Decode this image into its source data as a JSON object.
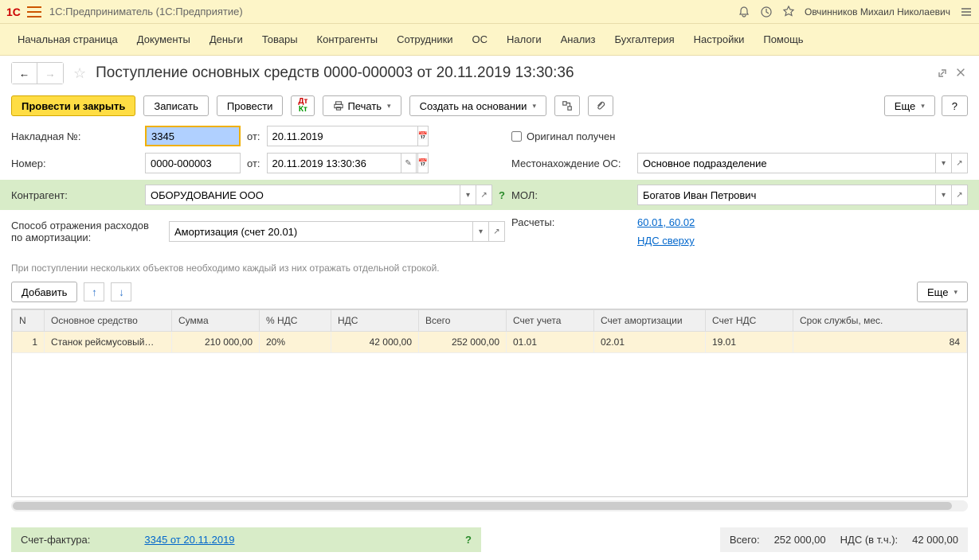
{
  "app": {
    "logo": "1C",
    "title": "1С:Предприниматель  (1С:Предприятие)",
    "user": "Овчинников Михаил Николаевич"
  },
  "menu": [
    "Начальная страница",
    "Документы",
    "Деньги",
    "Товары",
    "Контрагенты",
    "Сотрудники",
    "ОС",
    "Налоги",
    "Анализ",
    "Бухгалтерия",
    "Настройки",
    "Помощь"
  ],
  "page": {
    "title": "Поступление основных средств 0000-000003 от 20.11.2019 13:30:36"
  },
  "actions": {
    "post_close": "Провести и закрыть",
    "save": "Записать",
    "post": "Провести",
    "print": "Печать",
    "create_based": "Создать на основании",
    "more": "Еще",
    "help": "?"
  },
  "form": {
    "invoice_label": "Накладная №:",
    "invoice_no": "3345",
    "from_label": "от:",
    "invoice_date": "20.11.2019",
    "number_label": "Номер:",
    "number": "0000-000003",
    "number_date": "20.11.2019 13:30:36",
    "original_label": "Оригинал получен",
    "counterparty_label": "Контрагент:",
    "counterparty": "ОБОРУДОВАНИЕ ООО",
    "location_label": "Местонахождение ОС:",
    "location": "Основное подразделение",
    "mol_label": "МОЛ:",
    "mol": "Богатов Иван Петрович",
    "expense_label": "Способ отражения расходов по амортизации:",
    "expense": "Амортизация (счет 20.01)",
    "settlements_label": "Расчеты:",
    "settlements": "60.01, 60.02",
    "vat_mode": "НДС сверху",
    "hint": "При поступлении нескольких объектов необходимо каждый из них отражать отдельной строкой.",
    "add": "Добавить"
  },
  "table": {
    "headers": [
      "N",
      "Основное средство",
      "Сумма",
      "% НДС",
      "НДС",
      "Всего",
      "Счет учета",
      "Счет амортизации",
      "Счет НДС",
      "Срок службы, мес."
    ],
    "rows": [
      {
        "n": "1",
        "name": "Станок рейсмусовый…",
        "sum": "210 000,00",
        "vat_rate": "20%",
        "vat": "42 000,00",
        "total": "252 000,00",
        "acct": "01.01",
        "amort_acct": "02.01",
        "vat_acct": "19.01",
        "life": "84"
      }
    ]
  },
  "footer": {
    "invoice_factura_label": "Счет-фактура:",
    "invoice_factura": "3345 от 20.11.2019",
    "total_label": "Всего:",
    "total": "252 000,00",
    "vat_incl_label": "НДС (в т.ч.):",
    "vat_incl": "42 000,00"
  }
}
